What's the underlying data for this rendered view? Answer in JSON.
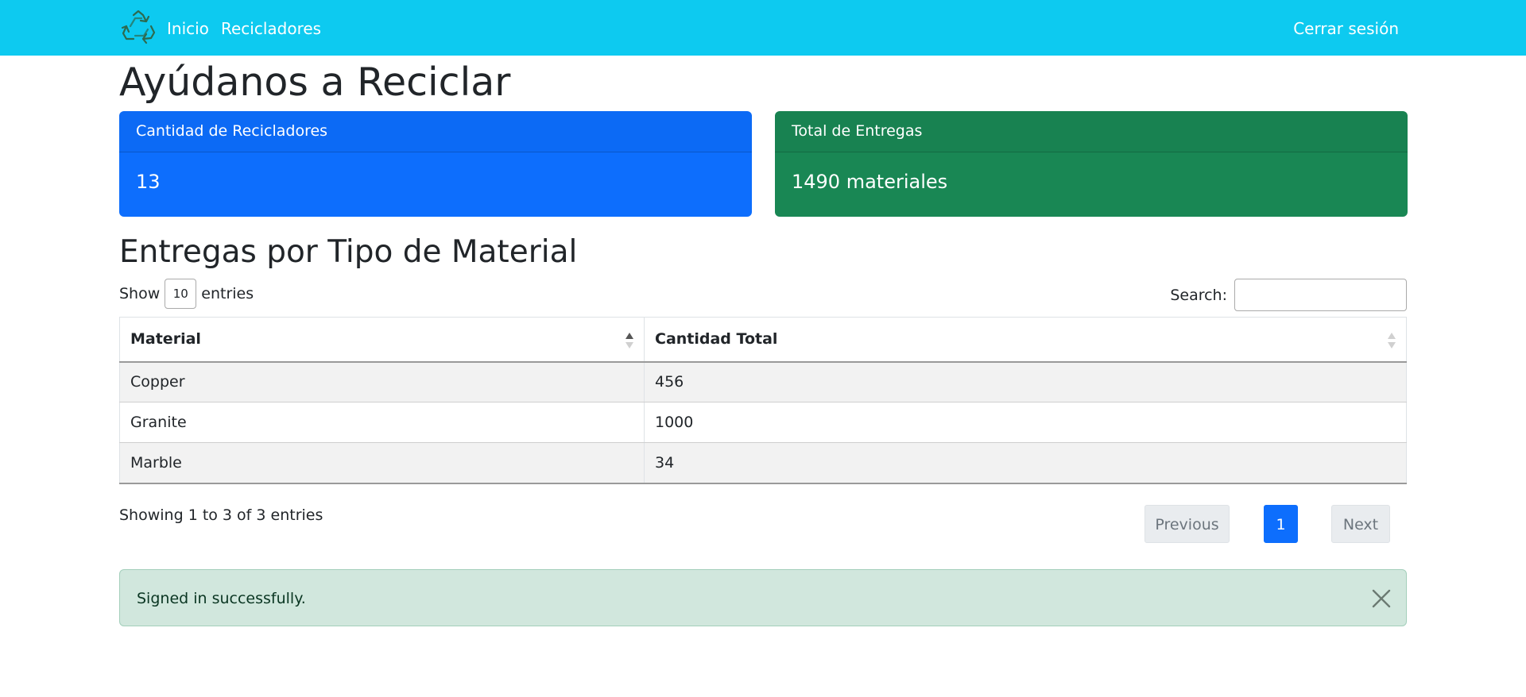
{
  "navbar": {
    "brand_icon": "recycle-icon",
    "links": [
      {
        "label": "Inicio"
      },
      {
        "label": "Recicladores"
      }
    ],
    "logout_label": "Cerrar sesión",
    "background_color": "#0dcaf0"
  },
  "page_title": "Ayúdanos a Reciclar",
  "cards": [
    {
      "header": "Cantidad de Recicladores",
      "value": "13",
      "color": "#0d6efd"
    },
    {
      "header": "Total de Entregas",
      "value": "1490 materiales",
      "color": "#198754"
    }
  ],
  "section_title": "Entregas por Tipo de Material",
  "table_controls": {
    "show_label": "Show",
    "length_value": "10",
    "entries_label": "entries",
    "search_label": "Search:",
    "search_value": ""
  },
  "table": {
    "columns": [
      "Material",
      "Cantidad Total"
    ],
    "sorted_column": "Material",
    "sort_direction": "ascending",
    "rows": [
      [
        "Copper",
        "456"
      ],
      [
        "Granite",
        "1000"
      ],
      [
        "Marble",
        "34"
      ]
    ]
  },
  "table_info": "Showing 1 to 3 of 3 entries",
  "pagination": {
    "previous_label": "Previous",
    "current_page": "1",
    "next_label": "Next",
    "active_color": "#0d6efd"
  },
  "alert": {
    "message": "Signed in successfully.",
    "type": "success",
    "close_icon": "close-icon"
  }
}
